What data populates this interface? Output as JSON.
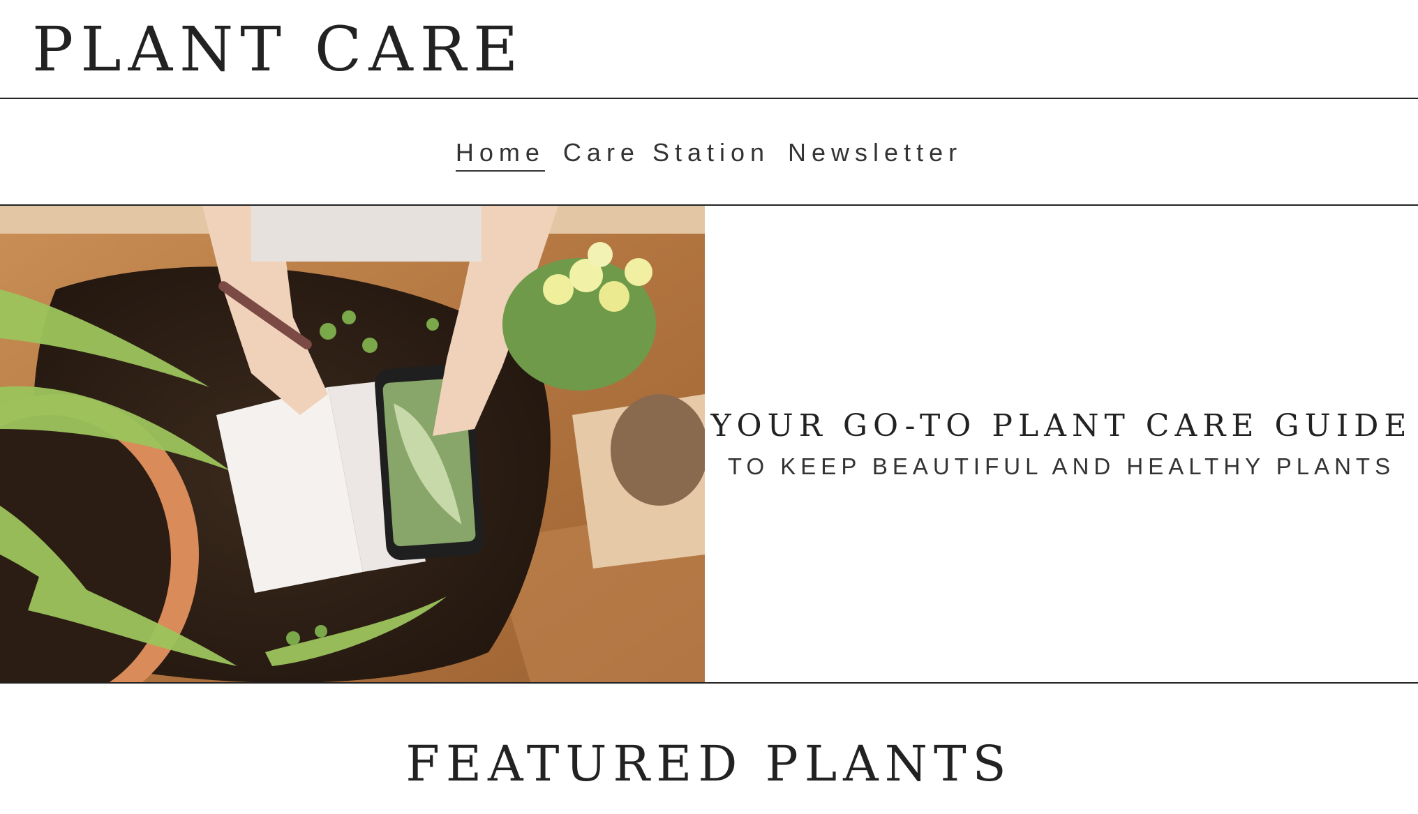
{
  "header": {
    "site_title": "PLANT CARE"
  },
  "nav": {
    "items": [
      {
        "label": "Home",
        "active": true
      },
      {
        "label": "Care Station",
        "active": false
      },
      {
        "label": "Newsletter",
        "active": false
      }
    ]
  },
  "hero": {
    "title": "YOUR GO-TO PLANT CARE GUIDE",
    "subtitle": "TO KEEP BEAUTIFUL AND HEALTHY PLANTS"
  },
  "featured": {
    "title": "FEATURED PLANTS"
  },
  "colors": {
    "text": "#222222",
    "background": "#ffffff",
    "divider": "#222222"
  }
}
